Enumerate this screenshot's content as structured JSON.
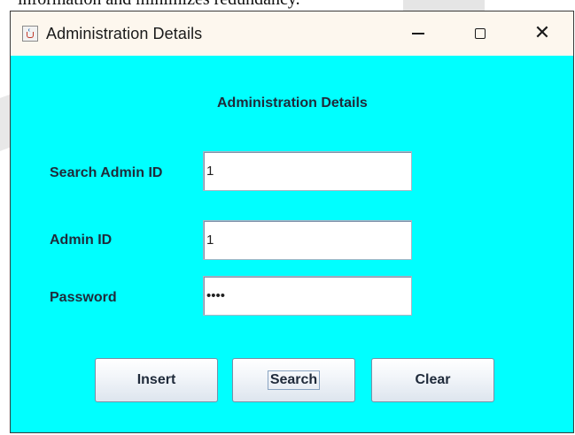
{
  "background": {
    "text": "information and minimizes redundancy."
  },
  "window": {
    "title": "Administration Details",
    "controls": {
      "minimize": "minimize-icon",
      "maximize": "maximize-icon",
      "close": "close-icon"
    }
  },
  "form": {
    "heading": "Administration Details",
    "search_label": "Search Admin ID",
    "search_value": "1",
    "admin_id_label": "Admin ID",
    "admin_id_value": "1",
    "password_label": "Password",
    "password_value": "••••"
  },
  "buttons": {
    "insert": "Insert",
    "search": "Search",
    "clear": "Clear"
  },
  "colors": {
    "form_background": "#00ffff",
    "titlebar": "#fdf7ee"
  }
}
